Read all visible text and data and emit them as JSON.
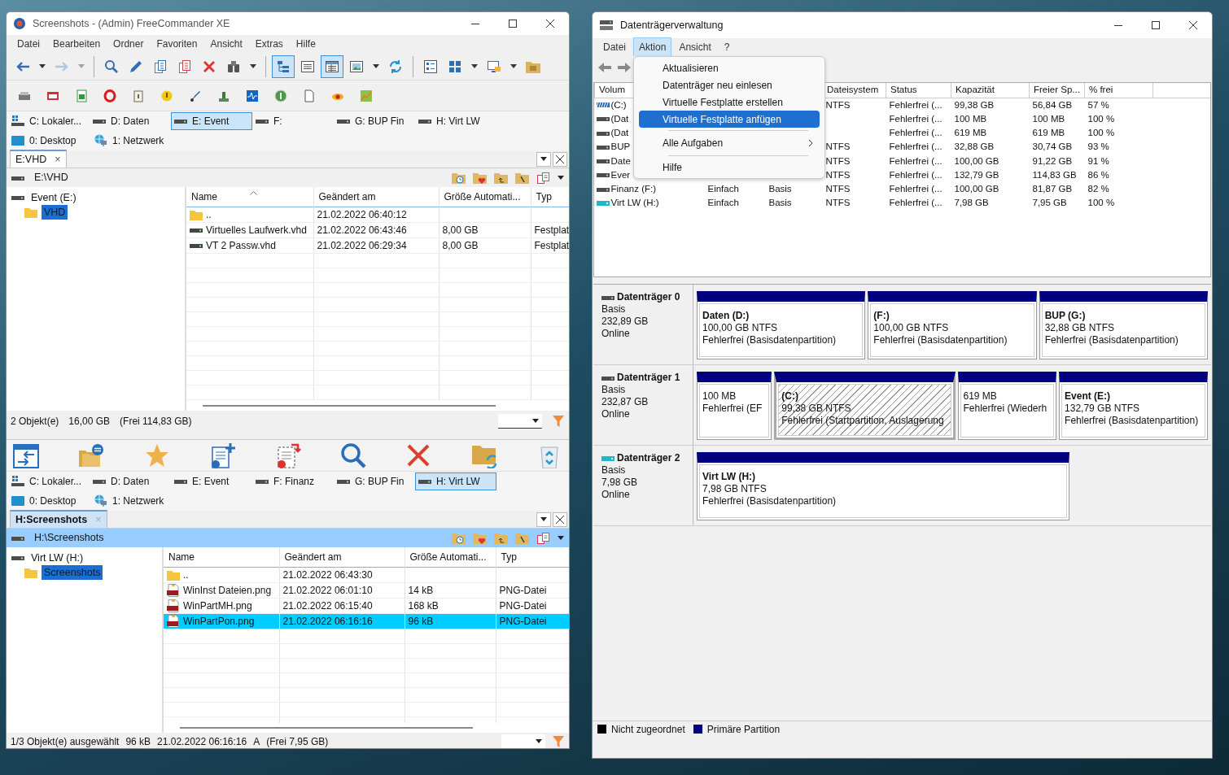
{
  "left_window": {
    "title": "Screenshots - (Admin) FreeCommander XE",
    "menu": [
      "Datei",
      "Bearbeiten",
      "Ordner",
      "Favoriten",
      "Ansicht",
      "Extras",
      "Hilfe"
    ],
    "toolbar": [
      {
        "kind": "button",
        "selected": false,
        "disabled": false,
        "dropdown": true
      },
      {
        "kind": "button",
        "selected": false,
        "disabled": true,
        "dropdown": true
      },
      {
        "kind": "separator"
      },
      {
        "kind": "button",
        "selected": false,
        "disabled": false,
        "dropdown": false
      },
      {
        "kind": "button",
        "selected": false,
        "disabled": false,
        "dropdown": false
      },
      {
        "kind": "button",
        "selected": false,
        "disabled": false,
        "dropdown": false
      },
      {
        "kind": "button",
        "selected": false,
        "disabled": false,
        "dropdown": false
      },
      {
        "kind": "button",
        "selected": false,
        "disabled": false,
        "dropdown": false
      },
      {
        "kind": "button",
        "selected": false,
        "disabled": false,
        "dropdown": true
      },
      {
        "kind": "separator"
      },
      {
        "kind": "button",
        "selected": true,
        "disabled": false,
        "dropdown": false
      },
      {
        "kind": "button",
        "selected": false,
        "disabled": false,
        "dropdown": false
      },
      {
        "kind": "button",
        "selected": true,
        "disabled": false,
        "dropdown": false
      },
      {
        "kind": "button",
        "selected": false,
        "disabled": false,
        "dropdown": true
      },
      {
        "kind": "button",
        "selected": false,
        "disabled": false,
        "dropdown": false
      },
      {
        "kind": "separator"
      },
      {
        "kind": "button",
        "selected": false,
        "disabled": false,
        "dropdown": false
      },
      {
        "kind": "button",
        "selected": false,
        "disabled": false,
        "dropdown": true
      },
      {
        "kind": "button",
        "selected": false,
        "disabled": false,
        "dropdown": true
      },
      {
        "kind": "button",
        "selected": false,
        "disabled": false,
        "dropdown": false
      }
    ],
    "panels": [
      {
        "active": false,
        "drives": [
          {
            "label": "C: Lokaler...",
            "kind": "system",
            "selected": false
          },
          {
            "label": "D: Daten",
            "kind": "disk",
            "selected": false
          },
          {
            "label": "E: Event",
            "kind": "disk",
            "selected": true
          },
          {
            "label": "F:",
            "kind": "disk",
            "selected": false
          },
          {
            "label": "G: BUP Fin",
            "kind": "disk",
            "selected": false
          },
          {
            "label": "H: Virt LW",
            "kind": "disk",
            "selected": false
          }
        ],
        "places": [
          {
            "label": "0: Desktop",
            "kind": "desktop"
          },
          {
            "label": "1: Netzwerk",
            "kind": "network"
          }
        ],
        "tab": {
          "label": "E:VHD",
          "close": "×"
        },
        "path": "E:\\VHD",
        "tree": [
          {
            "label": "Event (E:)",
            "kind": "drive",
            "selected": false,
            "children": [
              {
                "label": "VHD",
                "kind": "folder",
                "selected": true
              }
            ]
          }
        ],
        "columns": [
          {
            "label": "Name",
            "sorted": true
          },
          {
            "label": "Geändert am",
            "sorted": false
          },
          {
            "label": "Größe Automati...",
            "sorted": false
          },
          {
            "label": "Typ",
            "sorted": false
          }
        ],
        "rows": [
          {
            "kind": "folder",
            "name": "..",
            "modified": "21.02.2022 06:40:12",
            "selected": false
          },
          {
            "kind": "vhd",
            "name": "Virtuelles Laufwerk.vhd",
            "modified": "21.02.2022 06:43:46",
            "size": "8,00 GB",
            "type": "Festplat",
            "selected": false
          },
          {
            "kind": "vhd",
            "name": "VT 2 Passw.vhd",
            "modified": "21.02.2022 06:29:34",
            "size": "8,00 GB",
            "type": "Festplat",
            "selected": false
          }
        ],
        "status": [
          "2 Objekt(e)",
          "16,00 GB",
          "(Frei 114,83 GB)"
        ]
      },
      {
        "active": true,
        "drives": [
          {
            "label": "C: Lokaler...",
            "kind": "system",
            "selected": false
          },
          {
            "label": "D: Daten",
            "kind": "disk",
            "selected": false
          },
          {
            "label": "E: Event",
            "kind": "disk",
            "selected": false
          },
          {
            "label": "F: Finanz",
            "kind": "disk",
            "selected": false
          },
          {
            "label": "G: BUP Fin",
            "kind": "disk",
            "selected": false
          },
          {
            "label": "H: Virt LW",
            "kind": "disk",
            "selected": true
          }
        ],
        "places": [
          {
            "label": "0: Desktop",
            "kind": "desktop"
          },
          {
            "label": "1: Netzwerk",
            "kind": "network"
          }
        ],
        "tab": {
          "label": "H:Screenshots",
          "close": "×"
        },
        "path": "H:\\Screenshots",
        "tree": [
          {
            "label": "Virt LW (H:)",
            "kind": "drive",
            "selected": false,
            "children": [
              {
                "label": "Screenshots",
                "kind": "folder",
                "selected": true
              }
            ]
          }
        ],
        "columns": [
          {
            "label": "Name",
            "sorted": false
          },
          {
            "label": "Geändert am",
            "sorted": false
          },
          {
            "label": "Größe Automati...",
            "sorted": false
          },
          {
            "label": "Typ",
            "sorted": false
          }
        ],
        "rows": [
          {
            "kind": "folder",
            "name": "..",
            "modified": "21.02.2022 06:43:30",
            "selected": false
          },
          {
            "kind": "png",
            "name": "WinInst Dateien.png",
            "modified": "21.02.2022 06:01:10",
            "size": "14 kB",
            "type": "PNG-Datei",
            "selected": false
          },
          {
            "kind": "png",
            "name": "WinPartMH.png",
            "modified": "21.02.2022 06:15:40",
            "size": "168 kB",
            "type": "PNG-Datei",
            "selected": false
          },
          {
            "kind": "png",
            "name": "WinPartPon.png",
            "modified": "21.02.2022 06:16:16",
            "size": "96 kB",
            "type": "PNG-Datei",
            "selected": true
          }
        ],
        "status": [
          "1/3 Objekt(e) ausgewählt",
          "96 kB",
          "21.02.2022 06:16:16",
          "A",
          "(Frei 7,95 GB)"
        ]
      }
    ]
  },
  "right_window": {
    "title": "Datenträgerverwaltung",
    "menu": [
      {
        "label": "Datei",
        "selected": false
      },
      {
        "label": "Aktion",
        "selected": true
      },
      {
        "label": "Ansicht",
        "selected": false
      },
      {
        "label": "?",
        "selected": false
      }
    ],
    "context_menu": [
      {
        "kind": "item",
        "label": "Aktualisieren",
        "selected": false
      },
      {
        "kind": "item",
        "label": "Datenträger neu einlesen",
        "selected": false
      },
      {
        "kind": "item",
        "label": "Virtuelle Festplatte erstellen",
        "selected": false
      },
      {
        "kind": "item",
        "label": "Virtuelle Festplatte anfügen",
        "selected": true
      },
      {
        "kind": "separator"
      },
      {
        "kind": "submenu",
        "label": "Alle Aufgaben",
        "selected": false
      },
      {
        "kind": "separator"
      },
      {
        "kind": "item",
        "label": "Hilfe",
        "selected": false
      }
    ],
    "volume_columns": {
      "volume": "Volum",
      "filesystem": "Dateisystem",
      "status": "Status",
      "capacity": "Kapazität",
      "free": "Freier Sp...",
      "percent_free": "% frei"
    },
    "volumes": [
      {
        "kind": "system",
        "volume": "(C:)",
        "filesystem": "NTFS",
        "status": "Fehlerfrei (...",
        "capacity": "99,38 GB",
        "free": "56,84 GB",
        "percent_free": "57 %"
      },
      {
        "kind": "disk",
        "volume": "(Dat",
        "status": "Fehlerfrei (...",
        "capacity": "100 MB",
        "free": "100 MB",
        "percent_free": "100 %"
      },
      {
        "kind": "disk",
        "volume": "(Dat",
        "status": "Fehlerfrei (...",
        "capacity": "619 MB",
        "free": "619 MB",
        "percent_free": "100 %"
      },
      {
        "kind": "disk",
        "volume": "BUP",
        "filesystem": "NTFS",
        "status": "Fehlerfrei (...",
        "capacity": "32,88 GB",
        "free": "30,74 GB",
        "percent_free": "93 %"
      },
      {
        "kind": "disk",
        "volume": "Date",
        "filesystem": "NTFS",
        "status": "Fehlerfrei (...",
        "capacity": "100,00 GB",
        "free": "91,22 GB",
        "percent_free": "91 %"
      },
      {
        "kind": "disk",
        "volume": "Ever",
        "filesystem": "NTFS",
        "status": "Fehlerfrei (...",
        "capacity": "132,79 GB",
        "free": "114,83 GB",
        "percent_free": "86 %"
      },
      {
        "kind": "disk",
        "volume": "Finanz (F:)",
        "layout": "Einfach",
        "type": "Basis",
        "filesystem": "NTFS",
        "status": "Fehlerfrei (...",
        "capacity": "100,00 GB",
        "free": "81,87 GB",
        "percent_free": "82 %"
      },
      {
        "kind": "virtual",
        "volume": "Virt LW (H:)",
        "layout": "Einfach",
        "type": "Basis",
        "filesystem": "NTFS",
        "status": "Fehlerfrei (...",
        "capacity": "7,98 GB",
        "free": "7,95 GB",
        "percent_free": "100 %"
      }
    ],
    "disks": [
      {
        "kind": "disk",
        "name": "Datenträger 0",
        "type": "Basis",
        "size": "232,89 GB",
        "status": "Online",
        "partitions": [
          {
            "name": "Daten  (D:)",
            "size": "100,00 GB NTFS",
            "status": "Fehlerfrei (Basisdatenpartition)",
            "selected": false
          },
          {
            "name": "(F:)",
            "size": "100,00 GB NTFS",
            "status": "Fehlerfrei (Basisdatenpartition)",
            "selected": false
          },
          {
            "name": "BUP  (G:)",
            "size": "32,88 GB NTFS",
            "status": "Fehlerfrei (Basisdatenpartition)",
            "selected": false
          }
        ]
      },
      {
        "kind": "disk",
        "name": "Datenträger 1",
        "type": "Basis",
        "size": "232,87 GB",
        "status": "Online",
        "partitions": [
          {
            "size": "100 MB",
            "status": "Fehlerfrei (EF",
            "selected": false
          },
          {
            "name": "(C:)",
            "size": "99,38 GB NTFS",
            "status": "Fehlerfrei (Startpartition, Auslagerung",
            "selected": true
          },
          {
            "size": "619 MB",
            "status": "Fehlerfrei (Wiederh",
            "selected": false
          },
          {
            "name": "Event  (E:)",
            "size": "132,79 GB NTFS",
            "status": "Fehlerfrei (Basisdatenpartition)",
            "selected": false
          }
        ]
      },
      {
        "kind": "virtual",
        "name": "Datenträger 2",
        "type": "Basis",
        "size": "7,98 GB",
        "status": "Online",
        "partitions": [
          {
            "name": "Virt LW  (H:)",
            "size": "7,98 GB NTFS",
            "status": "Fehlerfrei (Basisdatenpartition)",
            "selected": false
          }
        ]
      }
    ],
    "legend": [
      {
        "label": "Nicht zugeordnet",
        "color": "#000000"
      },
      {
        "label": "Primäre Partition",
        "color": "#000080"
      }
    ]
  }
}
